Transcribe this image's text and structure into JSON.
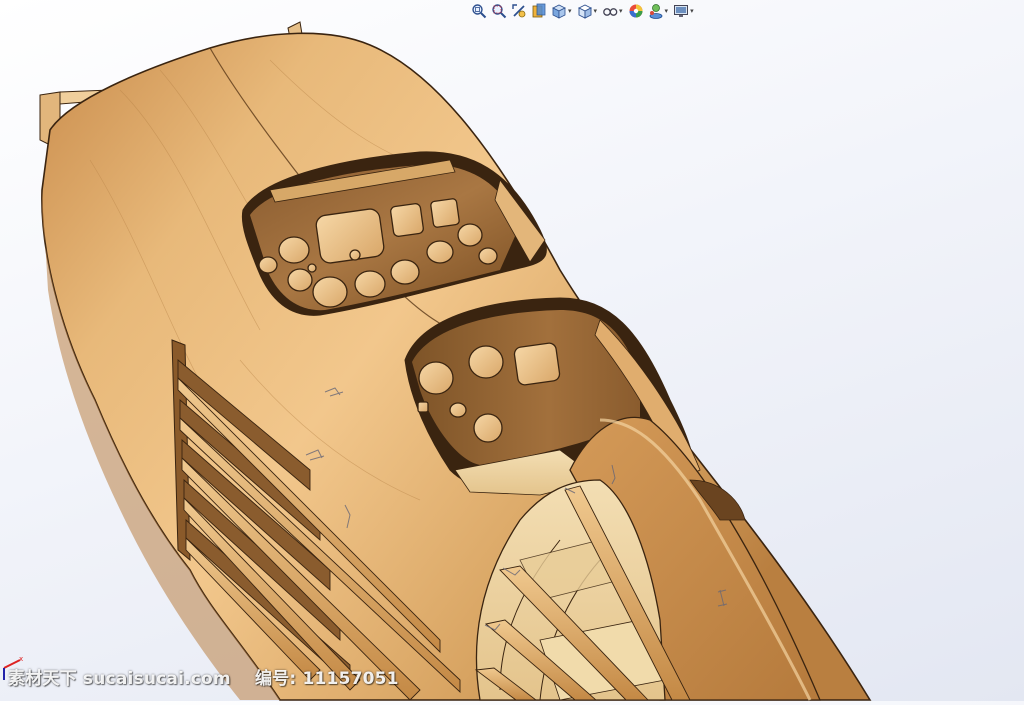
{
  "app": {
    "name": "SolidWorks 3D viewport"
  },
  "toolbar": {
    "tools": [
      {
        "name": "zoom-to-fit-icon",
        "dropdown": false
      },
      {
        "name": "zoom-to-area-icon",
        "dropdown": false
      },
      {
        "name": "previous-view-icon",
        "dropdown": false
      },
      {
        "name": "section-view-icon",
        "dropdown": false
      },
      {
        "name": "view-orientation-icon",
        "dropdown": true
      },
      {
        "name": "display-style-icon",
        "dropdown": true
      },
      {
        "name": "hide-show-items-icon",
        "dropdown": true
      },
      {
        "name": "edit-appearance-icon",
        "dropdown": false
      },
      {
        "name": "apply-scene-icon",
        "dropdown": true
      },
      {
        "name": "view-settings-icon",
        "dropdown": true
      }
    ],
    "dropdown_glyph": "▾"
  },
  "watermark": {
    "site": "素材天下 sucaisucai.com",
    "code_label": "编号: 11157051"
  },
  "colors": {
    "wood_light": "#e8b97a",
    "wood_mid": "#d39a57",
    "wood_dark": "#7a4e22",
    "edge": "#3a2410",
    "background": "#eef0f7"
  }
}
